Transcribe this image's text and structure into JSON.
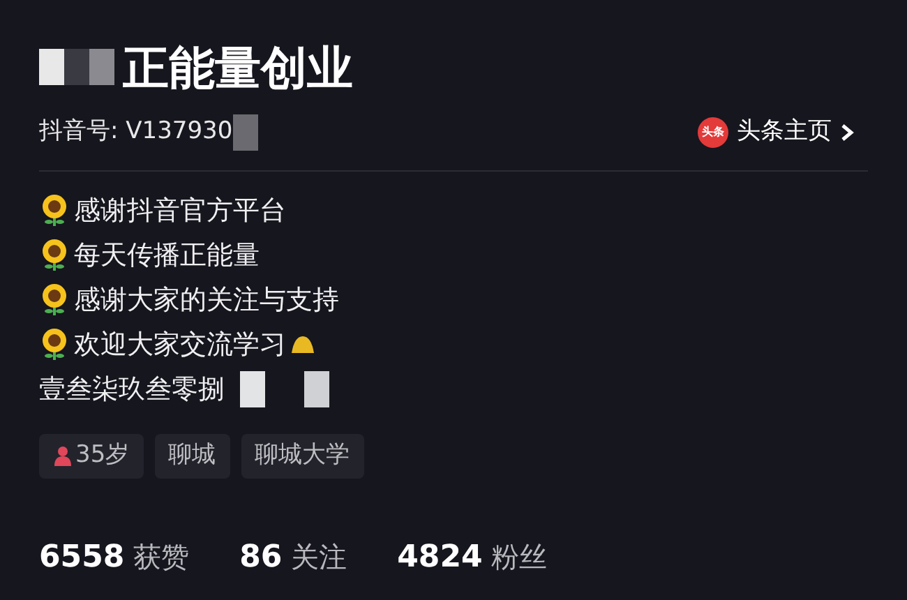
{
  "profile": {
    "name": "正能量创业",
    "douyin_id": "抖音号: V137930",
    "toutiao_link": "头条主页",
    "toutiao_badge": "头条"
  },
  "bio": [
    {
      "kind": "sunflower",
      "text": "感谢抖音官方平台"
    },
    {
      "kind": "sunflower",
      "text": "每天传播正能量"
    },
    {
      "kind": "sunflower",
      "text": "感谢大家的关注与支持"
    },
    {
      "kind": "sunflower",
      "text": "欢迎大家交流学习"
    },
    {
      "kind": "plain",
      "text": "壹叁柒玖叁零捌"
    }
  ],
  "tags": [
    {
      "kind": "gender",
      "text": "35岁"
    },
    {
      "kind": "plain",
      "text": "聊城"
    },
    {
      "kind": "plain",
      "text": "聊城大学"
    }
  ],
  "stats": [
    "**6558** 获赞",
    "**86** 关注",
    "**4824** 粉丝"
  ]
}
